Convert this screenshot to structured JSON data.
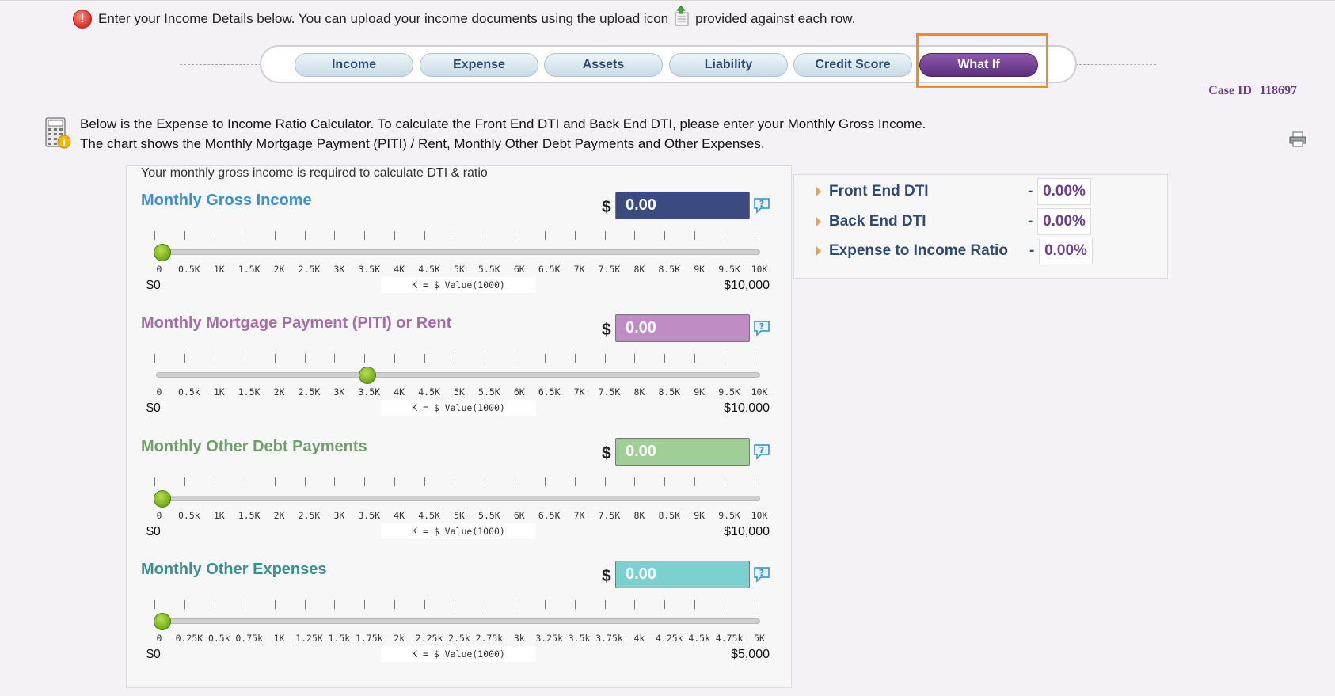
{
  "notice": {
    "text_before": "Enter your Income Details below. You can upload your income documents using the upload icon",
    "text_after": "provided against each row."
  },
  "tabs": [
    {
      "label": "Income",
      "active": false
    },
    {
      "label": "Expense",
      "active": false
    },
    {
      "label": "Assets",
      "active": false
    },
    {
      "label": "Liability",
      "active": false
    },
    {
      "label": "Credit Score",
      "active": false
    },
    {
      "label": "What If",
      "active": true
    }
  ],
  "case": {
    "label": "Case ID",
    "value": "118697"
  },
  "intro": {
    "line1": "Below is the Expense to Income Ratio Calculator. To calculate the Front End DTI and Back End DTI, please enter your Monthly Gross Income.",
    "line2": "The chart shows the Monthly Mortgage Payment (PITI) / Rent, Monthly Other Debt Payments and Other Expenses."
  },
  "panel_note": "Your monthly gross income is required to calculate DTI & ratio",
  "currency_symbol": "$",
  "k_legend": "K = $ Value(1000)",
  "sliders": [
    {
      "title": "Monthly Gross Income",
      "value": "0.00",
      "knob_fraction": 0.0,
      "title_color": "#3a8fd6",
      "field_color": "#3b4a80",
      "min_label": "$0",
      "max_label": "$10,000",
      "scale": [
        "0",
        "0.5K",
        "1K",
        "1.5K",
        "2K",
        "2.5K",
        "3K",
        "3.5K",
        "4K",
        "4.5K",
        "5K",
        "5.5K",
        "6K",
        "6.5K",
        "7K",
        "7.5K",
        "8K",
        "8.5K",
        "9K",
        "9.5K",
        "10K"
      ]
    },
    {
      "title": "Monthly Mortgage Payment (PITI) or Rent",
      "value": "0.00",
      "knob_fraction": 0.35,
      "title_color": "#a56ca8",
      "field_color": "#c08cc4",
      "min_label": "$0",
      "max_label": "$10,000",
      "scale": [
        "0",
        "0.5k",
        "1K",
        "1.5K",
        "2K",
        "2.5K",
        "3K",
        "3.5K",
        "4K",
        "4.5K",
        "5K",
        "5.5K",
        "6K",
        "6.5K",
        "7K",
        "7.5K",
        "8K",
        "8.5K",
        "9K",
        "9.5K",
        "10K"
      ]
    },
    {
      "title": "Monthly Other Debt Payments",
      "value": "0.00",
      "knob_fraction": 0.0,
      "title_color": "#6f9f68",
      "field_color": "#9fcf97",
      "min_label": "$0",
      "max_label": "$10,000",
      "scale": [
        "0",
        "0.5k",
        "1K",
        "1.5K",
        "2K",
        "2.5K",
        "3K",
        "3.5K",
        "4K",
        "4.5K",
        "5K",
        "5.5K",
        "6K",
        "6.5K",
        "7K",
        "7.5K",
        "8K",
        "8.5K",
        "9K",
        "9.5K",
        "10K"
      ]
    },
    {
      "title": "Monthly Other Expenses",
      "value": "0.00",
      "knob_fraction": 0.0,
      "title_color": "#3a8f8f",
      "field_color": "#7dd0d0",
      "min_label": "$0",
      "max_label": "$5,000",
      "scale": [
        "0",
        "0.25K",
        "0.5k",
        "0.75k",
        "1K",
        "1.25K",
        "1.5k",
        "1.75k",
        "2k",
        "2.25k",
        "2.5k",
        "2.75k",
        "3k",
        "3.25k",
        "3.5k",
        "3.75k",
        "4k",
        "4.25k",
        "4.5k",
        "4.75k",
        "5K"
      ]
    }
  ],
  "results": [
    {
      "label": "Front End DTI",
      "dash": "-",
      "value": "0.00%"
    },
    {
      "label": "Back End DTI",
      "dash": "-",
      "value": "0.00%"
    },
    {
      "label": "Expense to Income Ratio",
      "dash": "-",
      "value": "0.00%"
    }
  ]
}
